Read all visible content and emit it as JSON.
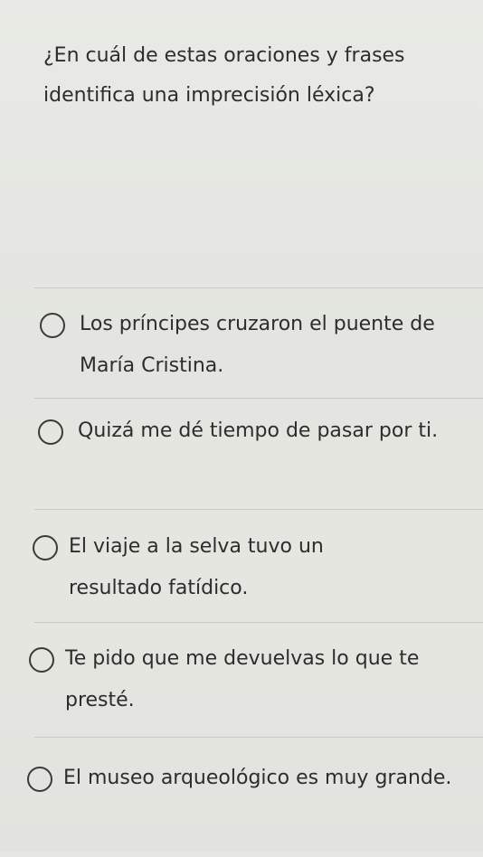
{
  "question": {
    "text": "¿En cuál de estas oraciones y frases identifica una imprecisión léxica?"
  },
  "options": [
    {
      "label": "Los príncipes cruzaron el puente de María Cristina."
    },
    {
      "label": "Quizá me dé tiempo de pasar por ti."
    },
    {
      "label": "El viaje a la selva tuvo un resultado fatídico."
    },
    {
      "label": "Te pido que me devuelvas lo que te presté."
    },
    {
      "label": "El museo arqueológico es muy grande."
    }
  ]
}
